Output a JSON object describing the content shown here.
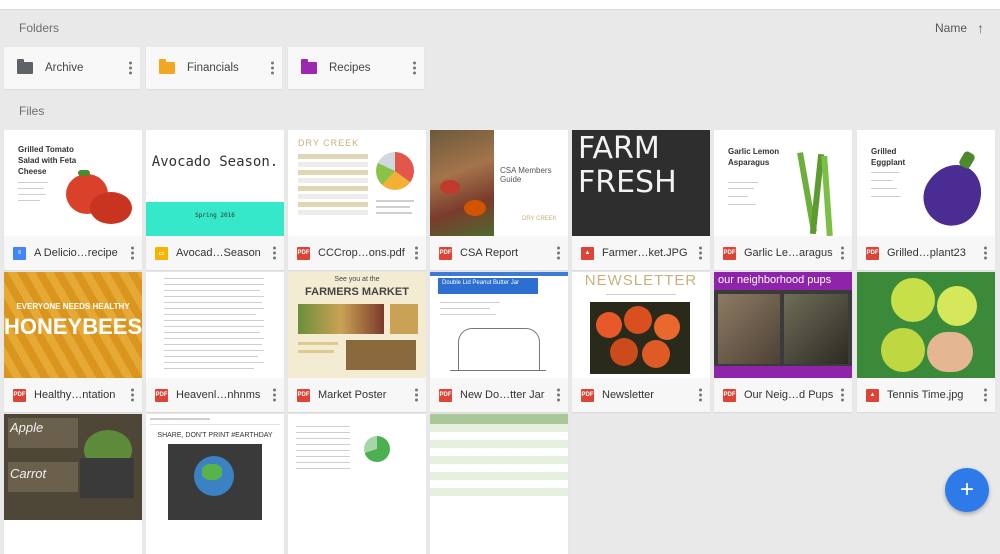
{
  "header": {
    "folders_label": "Folders",
    "sort_label": "Name",
    "sort_arrow": "↑"
  },
  "files_label": "Files",
  "colors": {
    "pdf": "#db4437",
    "doc": "#4285f4",
    "slides": "#f4b400",
    "image": "#db4437",
    "fab": "#2f7ae9"
  },
  "folders": [
    {
      "name": "Archive",
      "color": "#5f6368"
    },
    {
      "name": "Financials",
      "color": "#f4a623"
    },
    {
      "name": "Recipes",
      "color": "#9c27b0"
    }
  ],
  "files": [
    {
      "name": "A Delicio…recipe",
      "type": "doc",
      "icon": "doc-icon",
      "thumb_title": "Grilled Tomato Salad with Feta Cheese"
    },
    {
      "name": "Avocad…Season",
      "type": "slides",
      "icon": "slides-icon",
      "thumb_title": "Avocado Season.",
      "thumb_sub": "Spring 2016"
    },
    {
      "name": "CCCrop…ons.pdf",
      "type": "pdf",
      "icon": "pdf-icon",
      "thumb_title": "DRY CREEK"
    },
    {
      "name": "CSA Report",
      "type": "pdf",
      "icon": "pdf-icon",
      "thumb_title": "CSA Members Guide",
      "thumb_sub": "DRY CREEK"
    },
    {
      "name": "Farmer…ket.JPG",
      "type": "image",
      "icon": "image-icon",
      "thumb_title": "FARM FRESH"
    },
    {
      "name": "Garlic Le…aragus",
      "type": "pdf",
      "icon": "pdf-icon",
      "thumb_title": "Garlic Lemon Asparagus"
    },
    {
      "name": "Grilled…plant23",
      "type": "pdf",
      "icon": "pdf-icon",
      "thumb_title": "Grilled Eggplant"
    },
    {
      "name": "Healthy…ntation",
      "type": "pdf",
      "icon": "pdf-icon",
      "thumb_title": "HONEYBEES",
      "thumb_sub": "EVERYONE NEEDS HEALTHY"
    },
    {
      "name": "Heavenl…nhnms",
      "type": "pdf",
      "icon": "pdf-icon"
    },
    {
      "name": "Market Poster",
      "type": "pdf",
      "icon": "pdf-icon",
      "thumb_title": "FARMERS MARKET",
      "thumb_sub": "See you at the"
    },
    {
      "name": "New Do…tter Jar",
      "type": "pdf",
      "icon": "pdf-icon",
      "thumb_title": "Double Lid Peanut Butter Jar"
    },
    {
      "name": "Newsletter",
      "type": "pdf",
      "icon": "pdf-icon",
      "thumb_title": "NEWSLETTER"
    },
    {
      "name": "Our Neig…d Pups",
      "type": "pdf",
      "icon": "pdf-icon",
      "thumb_title": "our neighborhood pups"
    },
    {
      "name": "Tennis Time.jpg",
      "type": "image",
      "icon": "image-icon"
    },
    {
      "name": "",
      "type": "image",
      "icon": "image-icon",
      "thumb_title": "Apple",
      "thumb_sub": "Carrot"
    },
    {
      "name": "",
      "type": "doc",
      "icon": "doc-icon",
      "thumb_title": "SHARE, DON'T PRINT  #EARTHDAY"
    },
    {
      "name": "",
      "type": "sheet",
      "icon": "sheet-icon"
    },
    {
      "name": "",
      "type": "sheet",
      "icon": "sheet-icon"
    }
  ],
  "fab": {
    "label": "+"
  }
}
